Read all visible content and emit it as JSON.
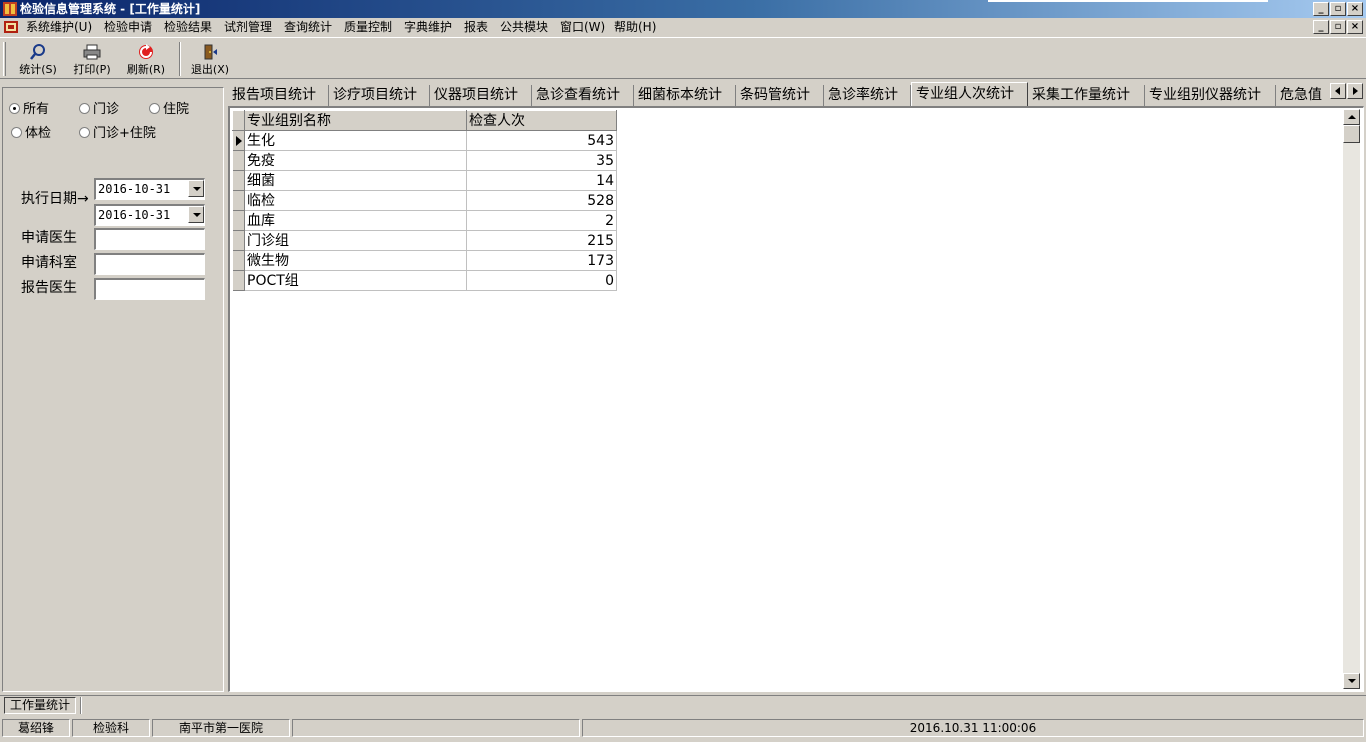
{
  "window": {
    "title": "检验信息管理系统 - [工作量统计]"
  },
  "menu": [
    "系统维护(U)",
    "检验申请",
    "检验结果",
    "试剂管理",
    "查询统计",
    "质量控制",
    "字典维护",
    "报表",
    "公共模块",
    "窗口(W)",
    "帮助(H)"
  ],
  "toolbar": {
    "stat_label": "统计(S)",
    "print_label": "打印(P)",
    "refresh_label": "刷新(R)",
    "exit_label": "退出(X)"
  },
  "filters": {
    "radio": {
      "all": "所有",
      "outpatient": "门诊",
      "inpatient": "住院",
      "physical": "体检",
      "out_in": "门诊+住院",
      "selected": "所有"
    },
    "exec_date_label": "执行日期→",
    "date_from": "2016-10-31",
    "date_to": "2016-10-31",
    "req_doctor_label": "申请医生",
    "req_doctor_value": "",
    "req_dept_label": "申请科室",
    "req_dept_value": "",
    "rep_doctor_label": "报告医生",
    "rep_doctor_value": ""
  },
  "tabs": [
    "报告项目统计",
    "诊疗项目统计",
    "仪器项目统计",
    "急诊查看统计",
    "细菌标本统计",
    "条码管统计",
    "急诊率统计",
    "专业组人次统计",
    "采集工作量统计",
    "专业组别仪器统计",
    "危急值"
  ],
  "active_tab": "专业组人次统计",
  "grid": {
    "columns": [
      "专业组别名称",
      "检查人次"
    ],
    "rows": [
      {
        "name": "生化",
        "count": "543"
      },
      {
        "name": "免疫",
        "count": "35"
      },
      {
        "name": "细菌",
        "count": "14"
      },
      {
        "name": "临检",
        "count": "528"
      },
      {
        "name": "血库",
        "count": "2"
      },
      {
        "name": "门诊组",
        "count": "215"
      },
      {
        "name": "微生物",
        "count": "173"
      },
      {
        "name": "POCT组",
        "count": "0"
      }
    ],
    "selected_row": 0
  },
  "window_tab": "工作量统计",
  "status": {
    "user": "葛绍锋",
    "dept": "检验科",
    "hospital": "南平市第一医院",
    "empty": "",
    "datetime": "2016.10.31  11:00:06"
  },
  "colors": {
    "title_start": "#0a246a",
    "title_end": "#a6caf0",
    "face": "#d4d0c8"
  }
}
